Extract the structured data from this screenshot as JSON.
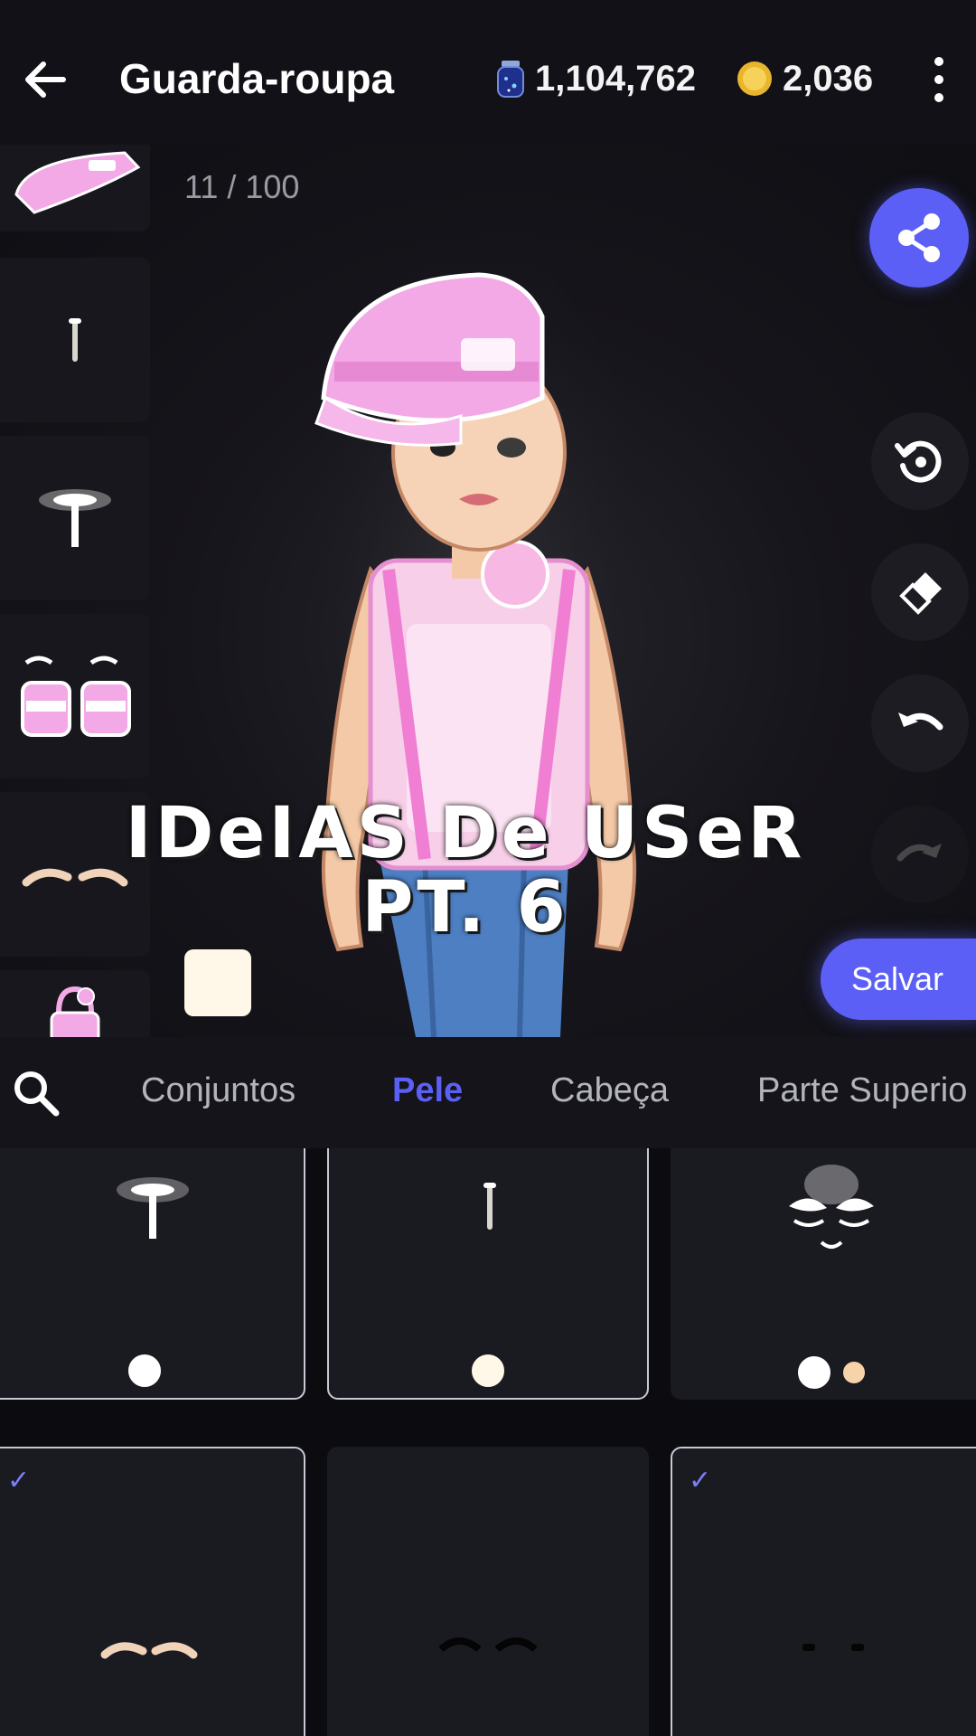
{
  "header": {
    "title": "Guarda-roupa",
    "gems": "1,104,762",
    "coins": "2,036",
    "back_icon": "arrow-left-icon",
    "more_icon": "more-vertical-icon"
  },
  "stage": {
    "counter": "11 / 100",
    "overlay_line1": "IDeIAS De USeR",
    "overlay_line2": "PT. 6",
    "save_label": "Salvar",
    "swatch_color": "#fff8e8",
    "thumbnails": [
      "pink-cap",
      "nose-piercing",
      "highlight",
      "pink-eyes",
      "eyebrows",
      "pink-bag"
    ]
  },
  "tools": [
    "share-icon",
    "reset-icon",
    "eraser-icon",
    "undo-icon",
    "redo-icon"
  ],
  "tabs": [
    "Conjuntos",
    "Pele",
    "Cabeça",
    "Parte Superio"
  ],
  "active_tab": "Pele",
  "grid": {
    "items": [
      {
        "name": "highlight",
        "colors": [
          "#ffffff"
        ],
        "selected": false
      },
      {
        "name": "nose-piercing",
        "colors": [
          "#fff8e8"
        ],
        "selected": false
      },
      {
        "name": "face-mask",
        "colors": [
          "#ffffff",
          "#f7d3a9"
        ],
        "selected": false
      },
      {
        "name": "eyebrows",
        "colors": [],
        "selected": true
      },
      {
        "name": "lashes",
        "colors": [],
        "selected": false
      },
      {
        "name": "dark-eyes",
        "colors": [],
        "selected": true
      }
    ]
  },
  "colors": {
    "accent": "#5b5ff5",
    "background": "#0d0d12",
    "pink": "#f3a9e6"
  }
}
